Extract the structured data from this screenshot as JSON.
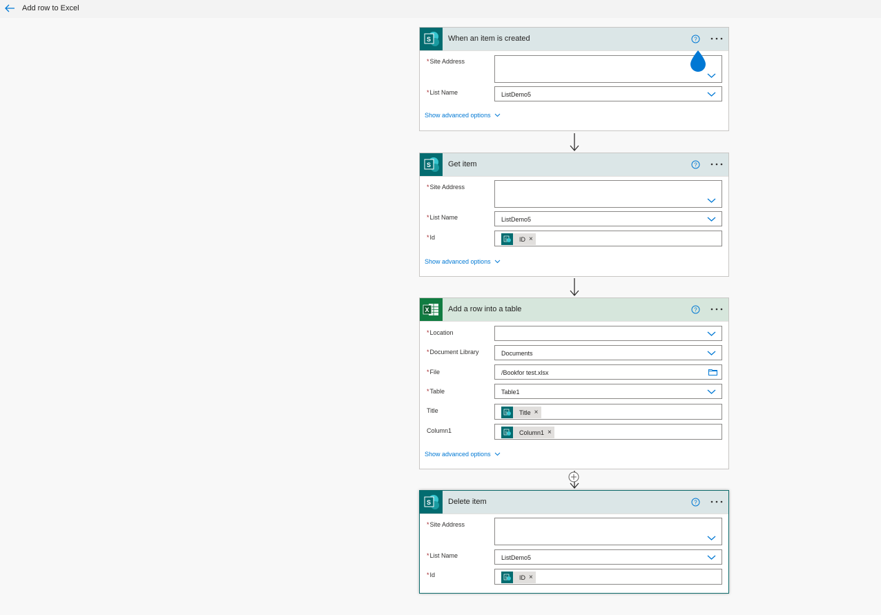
{
  "header": {
    "back_label": "Back",
    "title": "Add row to Excel"
  },
  "common": {
    "show_advanced": "Show advanced options"
  },
  "trigger": {
    "title": "When an item is created",
    "site_address_label": "Site Address",
    "site_address_value": "",
    "list_name_label": "List Name",
    "list_name_value": "ListDemo5"
  },
  "get_item": {
    "title": "Get item",
    "site_address_label": "Site Address",
    "site_address_value": "",
    "list_name_label": "List Name",
    "list_name_value": "ListDemo5",
    "id_label": "Id",
    "id_token": "ID"
  },
  "add_row": {
    "title": "Add a row into a table",
    "location_label": "Location",
    "location_value": "",
    "doc_library_label": "Document Library",
    "doc_library_value": "Documents",
    "file_label": "File",
    "file_value": "/Bookfor test.xlsx",
    "table_label": "Table",
    "table_value": "Table1",
    "title_label": "Title",
    "title_token": "Title",
    "column1_label": "Column1",
    "column1_token": "Column1"
  },
  "delete_item": {
    "title": "Delete item",
    "site_address_label": "Site Address",
    "site_address_value": "",
    "list_name_label": "List Name",
    "list_name_value": "ListDemo5",
    "id_label": "Id",
    "id_token": "ID"
  },
  "colors": {
    "sharepoint": "#036c70",
    "excel": "#107c41",
    "accent": "#0078d4",
    "required": "#a4262c"
  },
  "icons": [
    "back-arrow-icon",
    "sharepoint-icon",
    "excel-icon",
    "help-icon",
    "more-icon",
    "chevron-down-icon",
    "folder-icon",
    "plus-icon",
    "arrow-down-icon"
  ]
}
